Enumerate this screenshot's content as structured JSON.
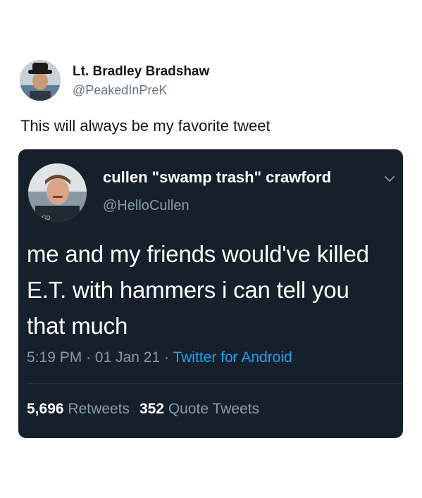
{
  "outer_tweet": {
    "display_name": "Lt. Bradley Bradshaw",
    "handle": "@PeakedInPreK",
    "text": "This will always be my favorite tweet"
  },
  "embedded_tweet": {
    "display_name": "cullen \"swamp trash\" crawford",
    "handle": "@HelloCullen",
    "text": "me and my friends would've killed E.T. with hammers i can tell you that much",
    "time": "5:19 PM",
    "date": "01 Jan 21",
    "separator": "·",
    "source": "Twitter for Android",
    "retweets_count": "5,696",
    "retweets_label": "Retweets",
    "quotes_count": "352",
    "quotes_label": "Quote Tweets"
  },
  "colors": {
    "embed_background": "#15202b",
    "secondary_text": "#8899a6",
    "link": "#1da1f2"
  },
  "icons": {
    "caret": "chevron-down-icon"
  }
}
